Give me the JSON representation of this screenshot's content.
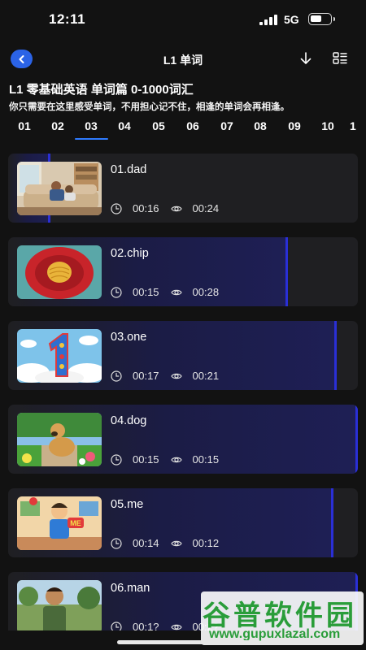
{
  "status_bar": {
    "time": "12:11",
    "network": "5G"
  },
  "nav": {
    "title": "L1 单词",
    "back_icon": "chevron-left-icon",
    "download_icon": "download-icon",
    "list_icon": "list-view-icon"
  },
  "header": {
    "title": "L1 零基础英语 单词篇 0-1000词汇",
    "subtitle": "你只需要在这里感受单词，不用担心记不住，相逢的单词会再相逢。"
  },
  "tabs": [
    "01",
    "02",
    "03",
    "04",
    "05",
    "06",
    "07",
    "08",
    "09",
    "10",
    "1"
  ],
  "active_tab": "03",
  "lessons": [
    {
      "title": "01.dad",
      "duration": "00:16",
      "views": "00:24",
      "progress": 0.12,
      "thumbnail": "dad reading to child on sofa"
    },
    {
      "title": "02.chip",
      "duration": "00:15",
      "views": "00:28",
      "progress": 0.8,
      "thumbnail": "potato chip on red plate"
    },
    {
      "title": "03.one",
      "duration": "00:17",
      "views": "00:21",
      "progress": 0.94,
      "thumbnail": "number one in clouds"
    },
    {
      "title": "04.dog",
      "duration": "00:15",
      "views": "00:15",
      "progress": 1.0,
      "thumbnail": "golden retriever in garden"
    },
    {
      "title": "05.me",
      "duration": "00:14",
      "views": "00:12",
      "progress": 0.93,
      "thumbnail": "cartoon boy pointing to himself"
    },
    {
      "title": "06.man",
      "duration": "00:1?",
      "views": "00:2?",
      "progress": 1.0,
      "thumbnail": "smiling man outdoors"
    }
  ],
  "watermark": {
    "main": "谷普软件园",
    "url": "www.gupuxlazal.com"
  },
  "colors": {
    "accent": "#2b63e6",
    "progress": "#2a2fd6",
    "background": "#121212",
    "card": "#1f1f22"
  }
}
